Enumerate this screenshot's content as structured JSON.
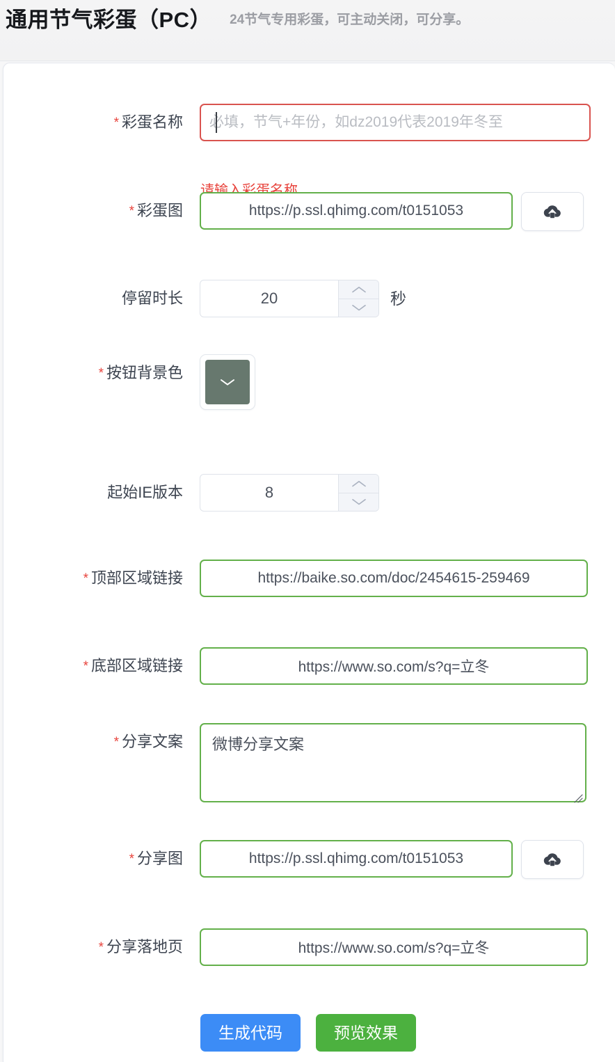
{
  "header": {
    "title": "通用节气彩蛋（PC）",
    "subtitle": "24节气专用彩蛋，可主动关闭，可分享。"
  },
  "form": {
    "required_mark": "*",
    "fields": {
      "egg_name": {
        "label": "彩蛋名称",
        "placeholder": "必填，节气+年份，如dz2019代表2019年冬至",
        "value": "",
        "error": "请输入彩蛋名称",
        "required": true,
        "state": "error"
      },
      "egg_image": {
        "label": "彩蛋图",
        "value": "https://p.ssl.qhimg.com/t0151053",
        "required": true,
        "state": "valid",
        "upload_icon": "cloud-upload-icon"
      },
      "stay_duration": {
        "label": "停留时长",
        "value": "20",
        "suffix": "秒",
        "required": false
      },
      "button_bg_color": {
        "label": "按钮背景色",
        "value": "#67786e",
        "required": true,
        "chevron_icon": "chevron-down-icon"
      },
      "ie_start_version": {
        "label": "起始IE版本",
        "value": "8",
        "required": false
      },
      "top_area_link": {
        "label": "顶部区域链接",
        "value": "https://baike.so.com/doc/2454615-259469",
        "required": true,
        "state": "valid"
      },
      "bottom_area_link": {
        "label": "底部区域链接",
        "value": "https://www.so.com/s?q=立冬",
        "required": true,
        "state": "valid"
      },
      "share_text": {
        "label": "分享文案",
        "value": "微博分享文案",
        "required": true,
        "state": "valid"
      },
      "share_image": {
        "label": "分享图",
        "value": "https://p.ssl.qhimg.com/t0151053",
        "required": true,
        "state": "valid",
        "upload_icon": "cloud-upload-icon"
      },
      "share_landing_page": {
        "label": "分享落地页",
        "value": "https://www.so.com/s?q=立冬",
        "required": true,
        "state": "valid"
      }
    },
    "stepper": {
      "up_icon": "chevron-up-icon",
      "down_icon": "chevron-down-icon"
    }
  },
  "actions": {
    "generate_code": "生成代码",
    "preview": "预览效果"
  },
  "colors": {
    "valid_border": "#63b04a",
    "error_border": "#d9534f",
    "error_text": "#e8433c",
    "primary_button": "#3c8cf6",
    "success_button": "#4cb13f",
    "swatch": "#67786e"
  }
}
